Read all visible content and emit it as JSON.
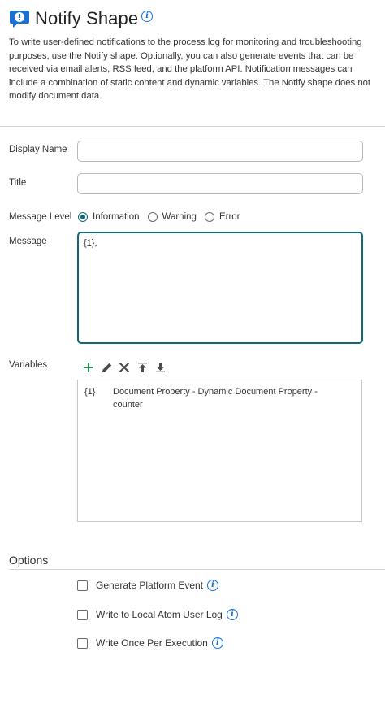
{
  "header": {
    "title": "Notify Shape",
    "icon": "notify-shape-icon",
    "info_icon": "info-icon",
    "accent_color": "#1a6fd8"
  },
  "description": "To write user-defined notifications to the process log for monitoring and troubleshooting purposes, use the Notify shape. Optionally, you can also generate events that can be received via email alerts, RSS feed, and the platform API. Notification messages can include a combination of static content and dynamic variables. The Notify shape does not modify document data.",
  "form": {
    "display_name": {
      "label": "Display Name",
      "value": ""
    },
    "title": {
      "label": "Title",
      "value": ""
    },
    "message_level": {
      "label": "Message Level",
      "options": [
        "Information",
        "Warning",
        "Error"
      ],
      "selected": "Information"
    },
    "message": {
      "label": "Message",
      "value": "{1},"
    }
  },
  "variables": {
    "label": "Variables",
    "toolbar": [
      "add-icon",
      "edit-icon",
      "delete-icon",
      "move-up-icon",
      "move-down-icon"
    ],
    "rows": [
      {
        "key": "{1}",
        "value": "Document Property - Dynamic Document Property - counter"
      }
    ]
  },
  "options": {
    "title": "Options",
    "checkboxes": [
      {
        "label": "Generate Platform Event",
        "checked": false
      },
      {
        "label": "Write to Local Atom User Log",
        "checked": false
      },
      {
        "label": "Write Once Per Execution",
        "checked": false
      }
    ]
  },
  "colors": {
    "focus_border": "#0e6a78",
    "add_icon": "#2e8b57",
    "info_icon": "#1a6fd8"
  }
}
